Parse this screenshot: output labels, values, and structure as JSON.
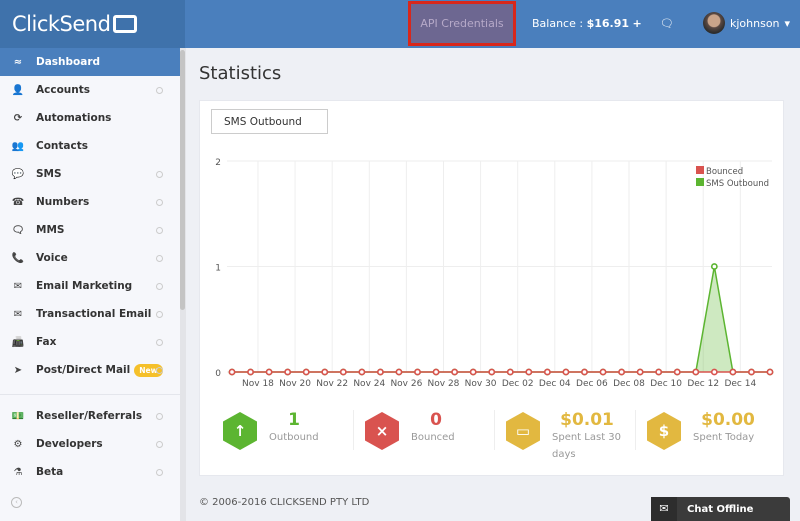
{
  "header": {
    "logo": "ClickSend",
    "api_credentials": "API Credentials",
    "balance_label": "Balance :",
    "balance_value": "$16.91",
    "add_icon": "+",
    "chat_icon": "speech-bubble",
    "username": "kjohnson",
    "caret": "▾"
  },
  "sidebar": {
    "items": [
      {
        "label": "Dashboard",
        "icon": "≈",
        "active": true,
        "dot": false
      },
      {
        "label": "Accounts",
        "icon": "👤",
        "dot": true
      },
      {
        "label": "Automations",
        "icon": "⟳",
        "dot": false
      },
      {
        "label": "Contacts",
        "icon": "👥",
        "dot": false
      },
      {
        "label": "SMS",
        "icon": "💬",
        "dot": true
      },
      {
        "label": "Numbers",
        "icon": "☎",
        "dot": true
      },
      {
        "label": "MMS",
        "icon": "🗨",
        "dot": true
      },
      {
        "label": "Voice",
        "icon": "📞",
        "dot": true
      },
      {
        "label": "Email Marketing",
        "icon": "✉",
        "dot": true
      },
      {
        "label": "Transactional Email",
        "icon": "✉",
        "dot": true
      },
      {
        "label": "Fax",
        "icon": "📠",
        "dot": true
      },
      {
        "label": "Post/Direct Mail",
        "icon": "➤",
        "dot": true,
        "badge": "New"
      },
      {
        "label": "Reseller/Referrals",
        "icon": "💵",
        "dot": true
      },
      {
        "label": "Developers",
        "icon": "⚙",
        "dot": true
      },
      {
        "label": "Beta",
        "icon": "⚗",
        "dot": true
      }
    ],
    "collapse_icon": "‹"
  },
  "main": {
    "title": "Statistics",
    "select_value": "SMS Outbound"
  },
  "chart_data": {
    "type": "area",
    "ylim": [
      0,
      2
    ],
    "yticks": [
      "0",
      "1",
      "2"
    ],
    "xtick_labels": [
      "Nov 18",
      "Nov 20",
      "Nov 22",
      "Nov 24",
      "Nov 26",
      "Nov 28",
      "Nov 30",
      "Dec 02",
      "Dec 04",
      "Dec 06",
      "Dec 08",
      "Dec 10",
      "Dec 12",
      "Dec 14"
    ],
    "x": [
      "Nov 17",
      "Nov 18",
      "Nov 19",
      "Nov 20",
      "Nov 21",
      "Nov 22",
      "Nov 23",
      "Nov 24",
      "Nov 25",
      "Nov 26",
      "Nov 27",
      "Nov 28",
      "Nov 29",
      "Nov 30",
      "Dec 01",
      "Dec 02",
      "Dec 03",
      "Dec 04",
      "Dec 05",
      "Dec 06",
      "Dec 07",
      "Dec 08",
      "Dec 09",
      "Dec 10",
      "Dec 11",
      "Dec 12",
      "Dec 13",
      "Dec 14",
      "Dec 15",
      "Dec 16"
    ],
    "series": [
      {
        "name": "Bounced",
        "color": "#d9534f",
        "values": [
          0,
          0,
          0,
          0,
          0,
          0,
          0,
          0,
          0,
          0,
          0,
          0,
          0,
          0,
          0,
          0,
          0,
          0,
          0,
          0,
          0,
          0,
          0,
          0,
          0,
          0,
          0,
          0,
          0,
          0
        ]
      },
      {
        "name": "SMS Outbound",
        "color": "#5cb531",
        "values": [
          0,
          0,
          0,
          0,
          0,
          0,
          0,
          0,
          0,
          0,
          0,
          0,
          0,
          0,
          0,
          0,
          0,
          0,
          0,
          0,
          0,
          0,
          0,
          0,
          0,
          0,
          1,
          0,
          0,
          0
        ]
      }
    ],
    "legend": "top-right",
    "grid": true
  },
  "stats": [
    {
      "value": "1",
      "label": "Outbound",
      "icon": "↑",
      "color": "#5cb531"
    },
    {
      "value": "0",
      "label": "Bounced",
      "icon": "×",
      "color": "#d9534f"
    },
    {
      "value": "$0.01",
      "label": "Spent Last 30 days",
      "icon": "▭",
      "color": "#e2b840"
    },
    {
      "value": "$0.00",
      "label": "Spent Today",
      "icon": "$",
      "color": "#e2b840"
    }
  ],
  "footer": {
    "copyright": "© 2006-2016 CLICKSEND PTY LTD",
    "chat": "Chat Offline",
    "chat_icon": "✉"
  }
}
